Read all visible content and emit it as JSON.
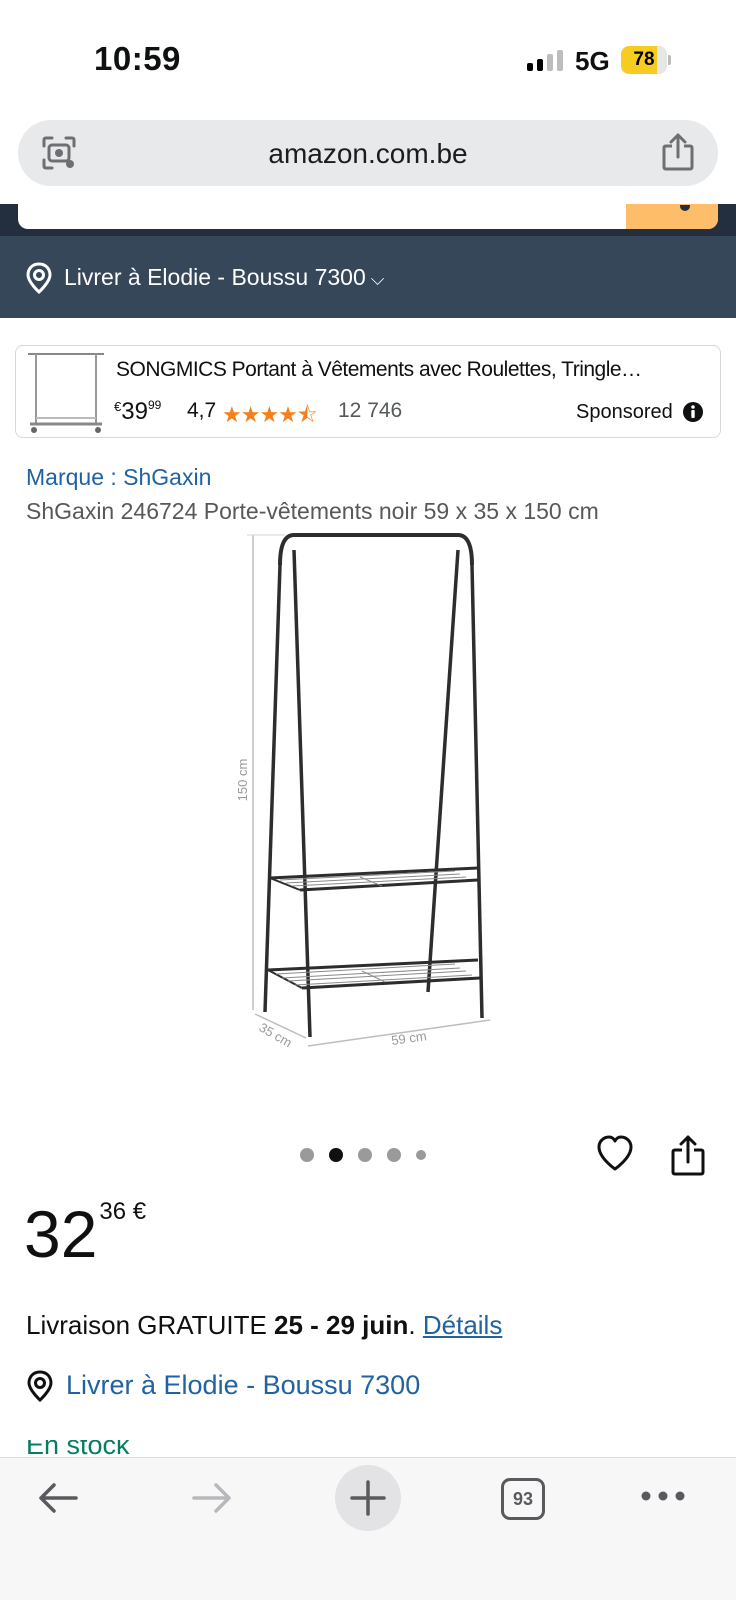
{
  "status_bar": {
    "time": "10:59",
    "network": "5G",
    "battery": "78",
    "battery_fraction": 0.78
  },
  "browser": {
    "url": "amazon.com.be",
    "tab_count": "93"
  },
  "header": {
    "deliver_to": "Livrer à Elodie - Boussu 7300"
  },
  "sponsored": {
    "title": "SONGMICS Portant à Vêtements avec Roulettes, Tringle…",
    "price_currency": "€",
    "price_whole": "39",
    "price_cents": "99",
    "rating": "4,7",
    "stars": "★★★★⯪",
    "review_count": "12 746",
    "label": "Sponsored"
  },
  "product": {
    "brand": "Marque : ShGaxin",
    "title": "ShGaxin 246724 Porte-vêtements noir 59 x 35 x 150 cm",
    "dimensions": {
      "height": "150 cm",
      "depth": "35 cm",
      "width": "59 cm"
    },
    "carousel": {
      "count": 5,
      "active_index": 1
    },
    "price_whole": "32",
    "price_fraction": "36 €"
  },
  "delivery": {
    "prefix": "Livraison GRATUITE ",
    "dates": "25 - 29 juin",
    "suffix": ". ",
    "details_link": "Détails",
    "location": "Livrer à Elodie - Boussu 7300",
    "partial_text": "En stock"
  },
  "colors": {
    "amazon_dark": "#232f3e",
    "amazon_header": "#37475a",
    "link_blue": "#2162a1",
    "star_orange": "#f47f1c",
    "search_button": "#febd69",
    "in_stock_green": "#067d62"
  }
}
